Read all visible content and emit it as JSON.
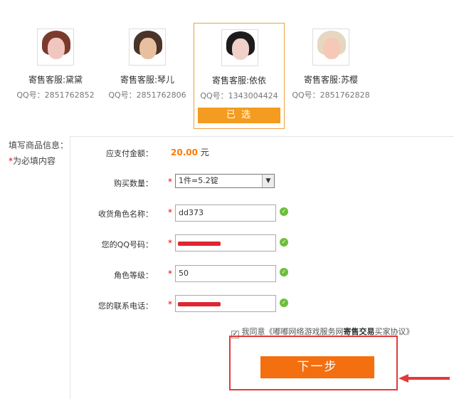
{
  "agents": [
    {
      "name": "寄售客服:黛黛",
      "qq": "QQ号：2851762852",
      "skin": "#f2c6c0",
      "hair": "#7b3b2c"
    },
    {
      "name": "寄售客服:琴儿",
      "qq": "QQ号：2851762806",
      "skin": "#e8c0a0",
      "hair": "#4a3428"
    },
    {
      "name": "寄售客服:依依",
      "qq": "QQ号：1343004424",
      "skin": "#f0d0c8",
      "hair": "#1c1c1c",
      "selected_label": "已 选"
    },
    {
      "name": "寄售客服:苏樱",
      "qq": "QQ号：2851762828",
      "skin": "#f5c8b8",
      "hair": "#e6d7c0"
    }
  ],
  "form": {
    "title": "填写商品信息：",
    "required_star": "*",
    "required_note": "为必填内容",
    "amount_label": "应支付金额：",
    "amount_value": "20.00",
    "amount_unit": "元",
    "quantity_label": "购买数量：",
    "quantity_value": "1件=5.2锭",
    "role_label": "收货角色名称：",
    "role_value": "dd373",
    "qq_label": "您的QQ号码：",
    "level_label": "角色等级：",
    "level_value": "50",
    "phone_label": "您的联系电话："
  },
  "agreement": {
    "prefix": "我同意《",
    "site": "嘟嘟网络游戏服务网",
    "bold": "寄售交易",
    "suffix": "买家协议》"
  },
  "next_button": "下一步",
  "colors": {
    "accent": "#f36f10",
    "selected": "#f39c1f",
    "required": "#e00",
    "highlight": "#e23a3a"
  }
}
